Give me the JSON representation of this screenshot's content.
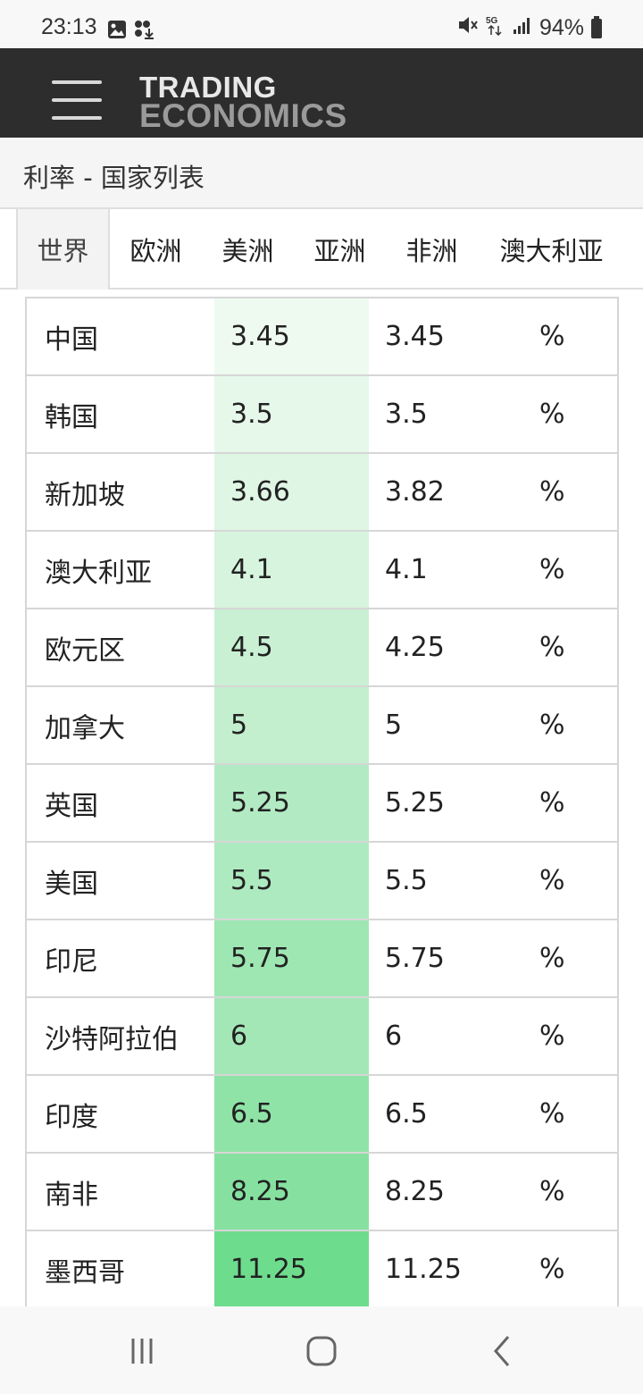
{
  "status_bar": {
    "time": "23:13",
    "battery": "94%"
  },
  "header": {
    "logo_line1": "TRADING",
    "logo_line2": "ECONOMICS"
  },
  "page": {
    "title": "利率 - 国家列表"
  },
  "tabs": [
    {
      "label": "世界",
      "active": true
    },
    {
      "label": "欧洲",
      "active": false
    },
    {
      "label": "美洲",
      "active": false
    },
    {
      "label": "亚洲",
      "active": false
    },
    {
      "label": "非洲",
      "active": false
    },
    {
      "label": "澳大利亚",
      "active": false
    }
  ],
  "table": {
    "rows": [
      {
        "country": "中国",
        "last": "3.45",
        "previous": "3.45",
        "unit": "%"
      },
      {
        "country": "韩国",
        "last": "3.5",
        "previous": "3.5",
        "unit": "%"
      },
      {
        "country": "新加坡",
        "last": "3.66",
        "previous": "3.82",
        "unit": "%"
      },
      {
        "country": "澳大利亚",
        "last": "4.1",
        "previous": "4.1",
        "unit": "%"
      },
      {
        "country": "欧元区",
        "last": "4.5",
        "previous": "4.25",
        "unit": "%"
      },
      {
        "country": "加拿大",
        "last": "5",
        "previous": "5",
        "unit": "%"
      },
      {
        "country": "英国",
        "last": "5.25",
        "previous": "5.25",
        "unit": "%"
      },
      {
        "country": "美国",
        "last": "5.5",
        "previous": "5.5",
        "unit": "%"
      },
      {
        "country": "印尼",
        "last": "5.75",
        "previous": "5.75",
        "unit": "%"
      },
      {
        "country": "沙特阿拉伯",
        "last": "6",
        "previous": "6",
        "unit": "%"
      },
      {
        "country": "印度",
        "last": "6.5",
        "previous": "6.5",
        "unit": "%"
      },
      {
        "country": "南非",
        "last": "8.25",
        "previous": "8.25",
        "unit": "%"
      },
      {
        "country": "墨西哥",
        "last": "11.25",
        "previous": "11.25",
        "unit": "%"
      }
    ],
    "heat_colors": [
      "#eefaf0",
      "#e6f8ea",
      "#dff6e4",
      "#d7f4de",
      "#c9f0d3",
      "#c4efcf",
      "#b2ebc3",
      "#aeeac0",
      "#9ee6b2",
      "#a4e7b7",
      "#8fe3a7",
      "#86e1a0",
      "#6edc8d"
    ]
  },
  "icons": {
    "menu": "hamburger-icon",
    "nav_recent": "recent-apps-icon",
    "nav_home": "home-icon",
    "nav_back": "back-icon"
  }
}
